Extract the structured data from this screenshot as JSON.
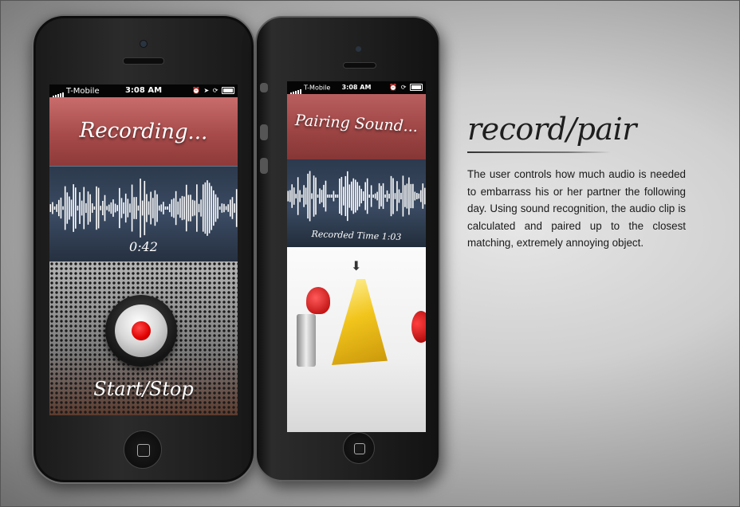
{
  "phone1": {
    "status": {
      "carrier": "T-Mobile",
      "time": "3:08 AM"
    },
    "title": "Recording...",
    "timer": "0:42",
    "button_label": "Start/Stop"
  },
  "phone2": {
    "status": {
      "carrier": "T-Mobile",
      "time": "3:08 AM"
    },
    "title": "Pairing Sound...",
    "recorded_time": "Recorded Time 1:03"
  },
  "heading": "record/pair",
  "description": "The user controls how much audio is needed to embarrass his or her partner the following day. Using sound recognition, the audio clip is calculated and paired up to the closest matching, extremely annoying object.",
  "colors": {
    "banner_red": "#a74a4a",
    "panel_blue": "#3b4b63",
    "record_red": "#e00000"
  }
}
